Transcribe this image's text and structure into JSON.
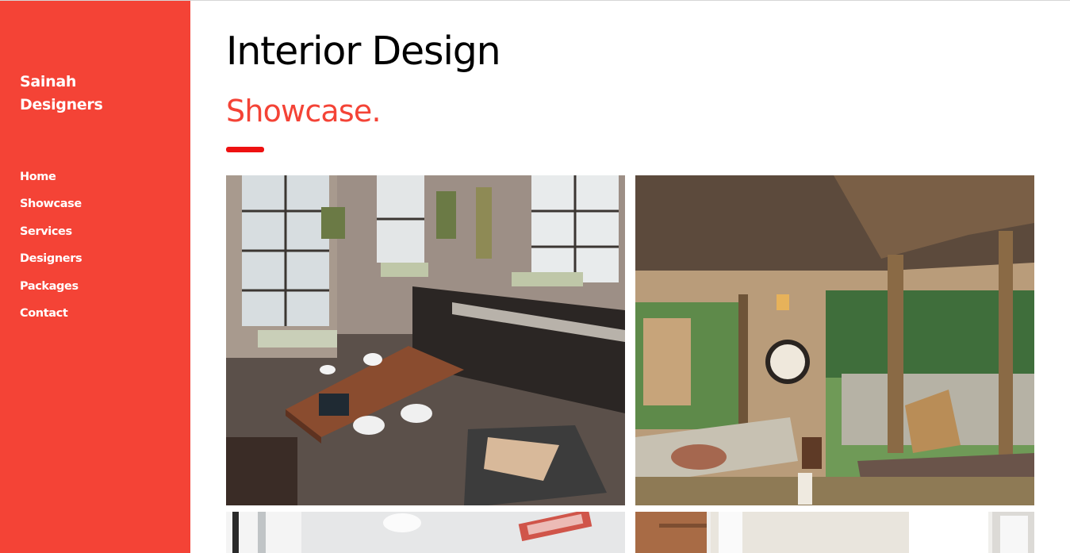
{
  "brand": {
    "line1": "Sainah",
    "line2": "Designers"
  },
  "nav": {
    "items": [
      {
        "label": "Home"
      },
      {
        "label": "Showcase"
      },
      {
        "label": "Services"
      },
      {
        "label": "Designers"
      },
      {
        "label": "Packages"
      },
      {
        "label": "Contact"
      }
    ]
  },
  "header": {
    "title": "Interior Design",
    "subtitle": "Showcase."
  },
  "showcase": {
    "photos": [
      {
        "subject": "loft-kitchen-dining"
      },
      {
        "subject": "cabin-living-room"
      },
      {
        "subject": "white-dining-room"
      },
      {
        "subject": "bright-room-windows"
      }
    ]
  },
  "colors": {
    "accent": "#f44336",
    "underline": "#ee1111",
    "text": "#000000"
  }
}
